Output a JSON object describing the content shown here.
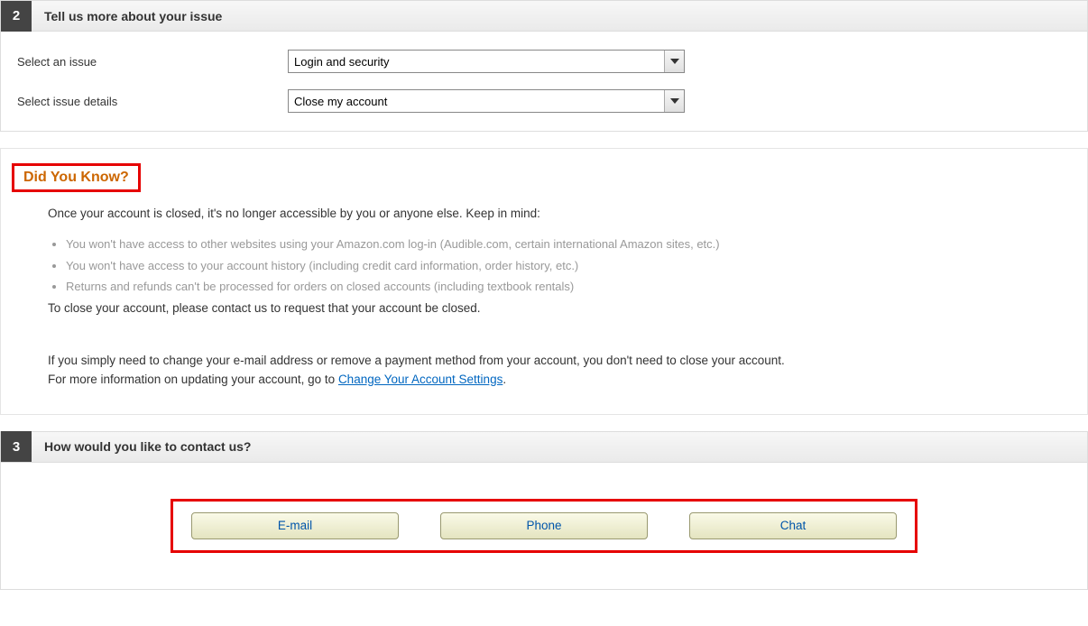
{
  "step2": {
    "number": "2",
    "title": "Tell us more about your issue",
    "issue_label": "Select an issue",
    "issue_value": "Login and security",
    "details_label": "Select issue details",
    "details_value": "Close my account"
  },
  "info": {
    "heading": "Did You Know?",
    "intro": "Once your account is closed, it's no longer accessible by you or anyone else. Keep in mind:",
    "bullets": [
      "You won't have access to other websites using your Amazon.com log-in (Audible.com, certain international Amazon sites, etc.)",
      "You won't have access to your account history (including credit card information, order history, etc.)",
      "Returns and refunds can't be processed for orders on closed accounts (including textbook rentals)"
    ],
    "close_note": "To close your account, please contact us to request that your account be closed.",
    "change_note_1": "If you simply need to change your e-mail address or remove a payment method from your account, you don't need to close your account.",
    "change_note_2a": "For more information on updating your account, go to ",
    "change_link": "Change Your Account Settings",
    "change_note_2b": "."
  },
  "step3": {
    "number": "3",
    "title": "How would you like to contact us?",
    "email_label": "E-mail",
    "phone_label": "Phone",
    "chat_label": "Chat"
  }
}
